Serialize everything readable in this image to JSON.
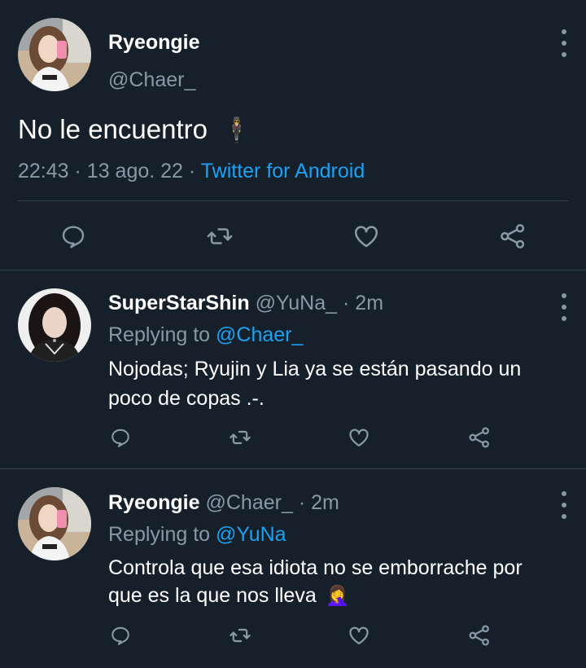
{
  "main_tweet": {
    "display_name": "Ryeongie",
    "handle": "@Chaer_",
    "text": "No le encuentro",
    "time": "22:43",
    "sep1": "·",
    "date": "13 ago. 22",
    "sep2": "·",
    "source": "Twitter for Android",
    "emoji": "🕴"
  },
  "replies": [
    {
      "display_name": "SuperStarShin",
      "handle": "@YuNa_",
      "age": "· 2m",
      "replying_prefix": "Replying to",
      "replying_to": "@Chaer_",
      "line1": "Nojodas; Ryujin y Lia ya se están pasando un",
      "line2": "poco de copas .-."
    },
    {
      "display_name": "Ryeongie",
      "handle": "@Chaer_",
      "age": "· 2m",
      "replying_prefix": "Replying to",
      "replying_to": "@YuNa",
      "line1": "Controla que esa idiota no se emborrache por",
      "line2": "que es la que nos lleva",
      "emoji": "🤦‍♀️"
    }
  ],
  "colors": {
    "background": "#15202b",
    "text": "#ffffff",
    "muted": "#8899a6",
    "link": "#1da1f2",
    "divider": "#38444d"
  },
  "icons": [
    "reply-icon",
    "retweet-icon",
    "like-icon",
    "share-icon",
    "more-options-icon"
  ]
}
